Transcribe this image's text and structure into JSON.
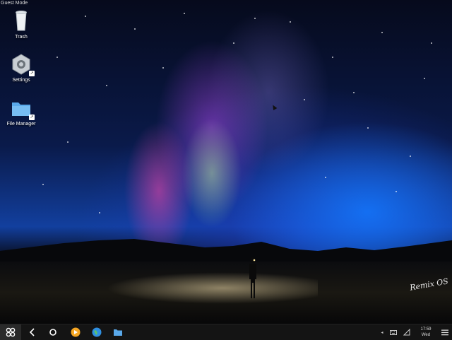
{
  "desktop": {
    "mode_label": "Guest Mode",
    "icons": [
      {
        "label": "Trash",
        "icon": "trash-icon"
      },
      {
        "label": "Settings",
        "icon": "gear-icon"
      },
      {
        "label": "File Manager",
        "icon": "folder-icon"
      }
    ],
    "brand": "Remix OS"
  },
  "taskbar": {
    "start_icon": "remix-start-icon",
    "nav": [
      "back-icon",
      "home-icon"
    ],
    "pinned_apps": [
      "play-store-icon",
      "browser-globe-icon",
      "file-manager-icon"
    ],
    "tray": [
      "caret-icon",
      "keyboard-icon",
      "signal-icon"
    ],
    "clock": {
      "time": "17:59",
      "day": "Wed"
    },
    "menu_icon": "hamburger-menu-icon"
  },
  "colors": {
    "taskbar_bg": "#141414",
    "accent_blue": "#2f8fe0",
    "play_store_orange": "#f5a623"
  }
}
